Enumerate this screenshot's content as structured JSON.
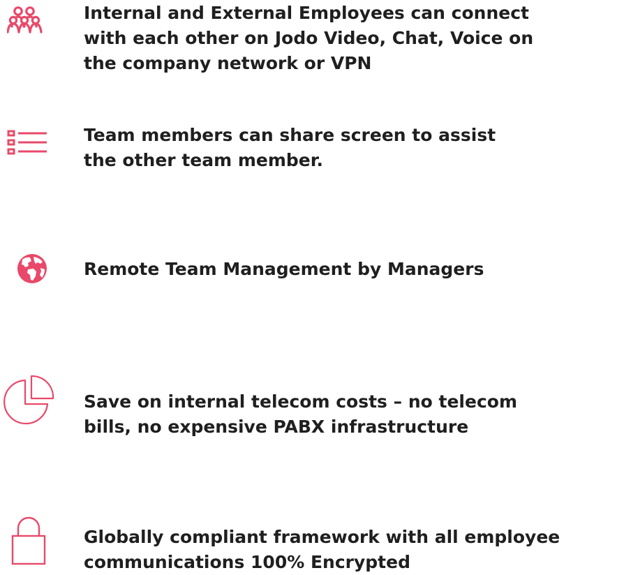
{
  "accent_color": "#e8496a",
  "text_color": "#1f1f1f",
  "features": [
    {
      "icon": "people-group-icon",
      "lines": [
        "Internal and External Employees can connect",
        "with each other on Jodo Video, Chat, Voice on",
        "the company network or VPN"
      ]
    },
    {
      "icon": "list-icon",
      "lines": [
        "Team members can share screen to assist",
        "the other team member."
      ]
    },
    {
      "icon": "globe-icon",
      "lines": [
        "Remote Team Management by Managers"
      ]
    },
    {
      "icon": "pie-chart-icon",
      "lines": [
        "Save on internal telecom costs – no telecom",
        "bills, no expensive PABX infrastructure"
      ]
    },
    {
      "icon": "lock-icon",
      "lines": [
        "Globally compliant framework with all employee",
        "communications 100% Encrypted"
      ]
    }
  ]
}
